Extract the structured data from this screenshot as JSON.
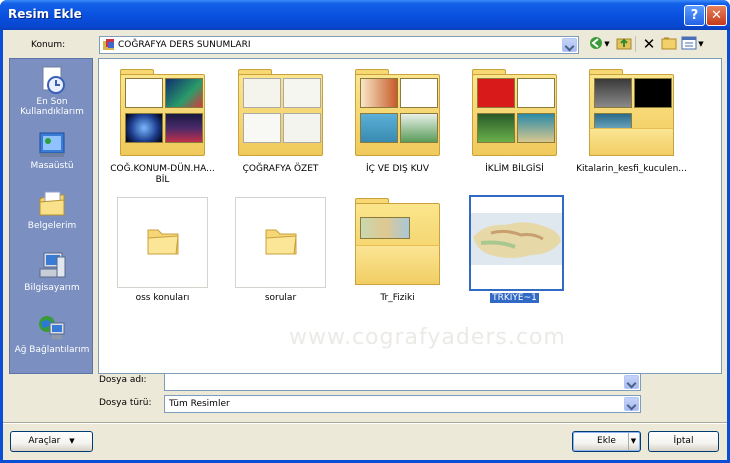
{
  "window": {
    "title": "Resim Ekle"
  },
  "titlebar_buttons": {
    "help": "?",
    "close": "✕"
  },
  "location": {
    "label": "Konum:",
    "value": "COĞRAFYA DERS SUNUMLARI"
  },
  "places": [
    {
      "label_line1": "En Son",
      "label_line2": "Kullandıklarım",
      "icon": "recent-documents-icon"
    },
    {
      "label_line1": "Masaüstü",
      "label_line2": "",
      "icon": "desktop-icon"
    },
    {
      "label_line1": "Belgelerim",
      "label_line2": "",
      "icon": "my-documents-icon"
    },
    {
      "label_line1": "Bilgisayarım",
      "label_line2": "",
      "icon": "my-computer-icon"
    },
    {
      "label_line1": "Ağ Bağlantılarım",
      "label_line2": "",
      "icon": "network-icon"
    }
  ],
  "items": [
    {
      "line1": "COĞ.KONUM-DÜN.HA...",
      "line2": "BİL",
      "type": "folder-preview"
    },
    {
      "line1": "ÇOĞRAFYA ÖZET",
      "line2": "",
      "type": "folder-preview"
    },
    {
      "line1": "İÇ VE DIŞ KUV",
      "line2": "",
      "type": "folder-preview"
    },
    {
      "line1": "İKLİM BİLGİSİ",
      "line2": "",
      "type": "folder-preview"
    },
    {
      "line1": "Kitalarin_kesfi_kuculen...",
      "line2": "",
      "type": "folder-preview"
    },
    {
      "line1": "oss konuları",
      "line2": "",
      "type": "folder"
    },
    {
      "line1": "sorular",
      "line2": "",
      "type": "folder"
    },
    {
      "line1": "Tr_Fiziki",
      "line2": "",
      "type": "folder-preview"
    },
    {
      "line1": "TRKİYE~1",
      "line2": "",
      "type": "image",
      "selected": true
    }
  ],
  "watermark": "www.cografyaders.com",
  "filename": {
    "label": "Dosya adı:",
    "value": ""
  },
  "filetype": {
    "label": "Dosya türü:",
    "value": "Tüm Resimler"
  },
  "buttons": {
    "tools": "Araçlar",
    "insert": "Ekle",
    "cancel": "İptal"
  },
  "colors": {
    "title_blue": "#0a52e0",
    "places_bg": "#7b8fc0",
    "selection": "#316ac5",
    "dialog_bg": "#ece9d8"
  }
}
